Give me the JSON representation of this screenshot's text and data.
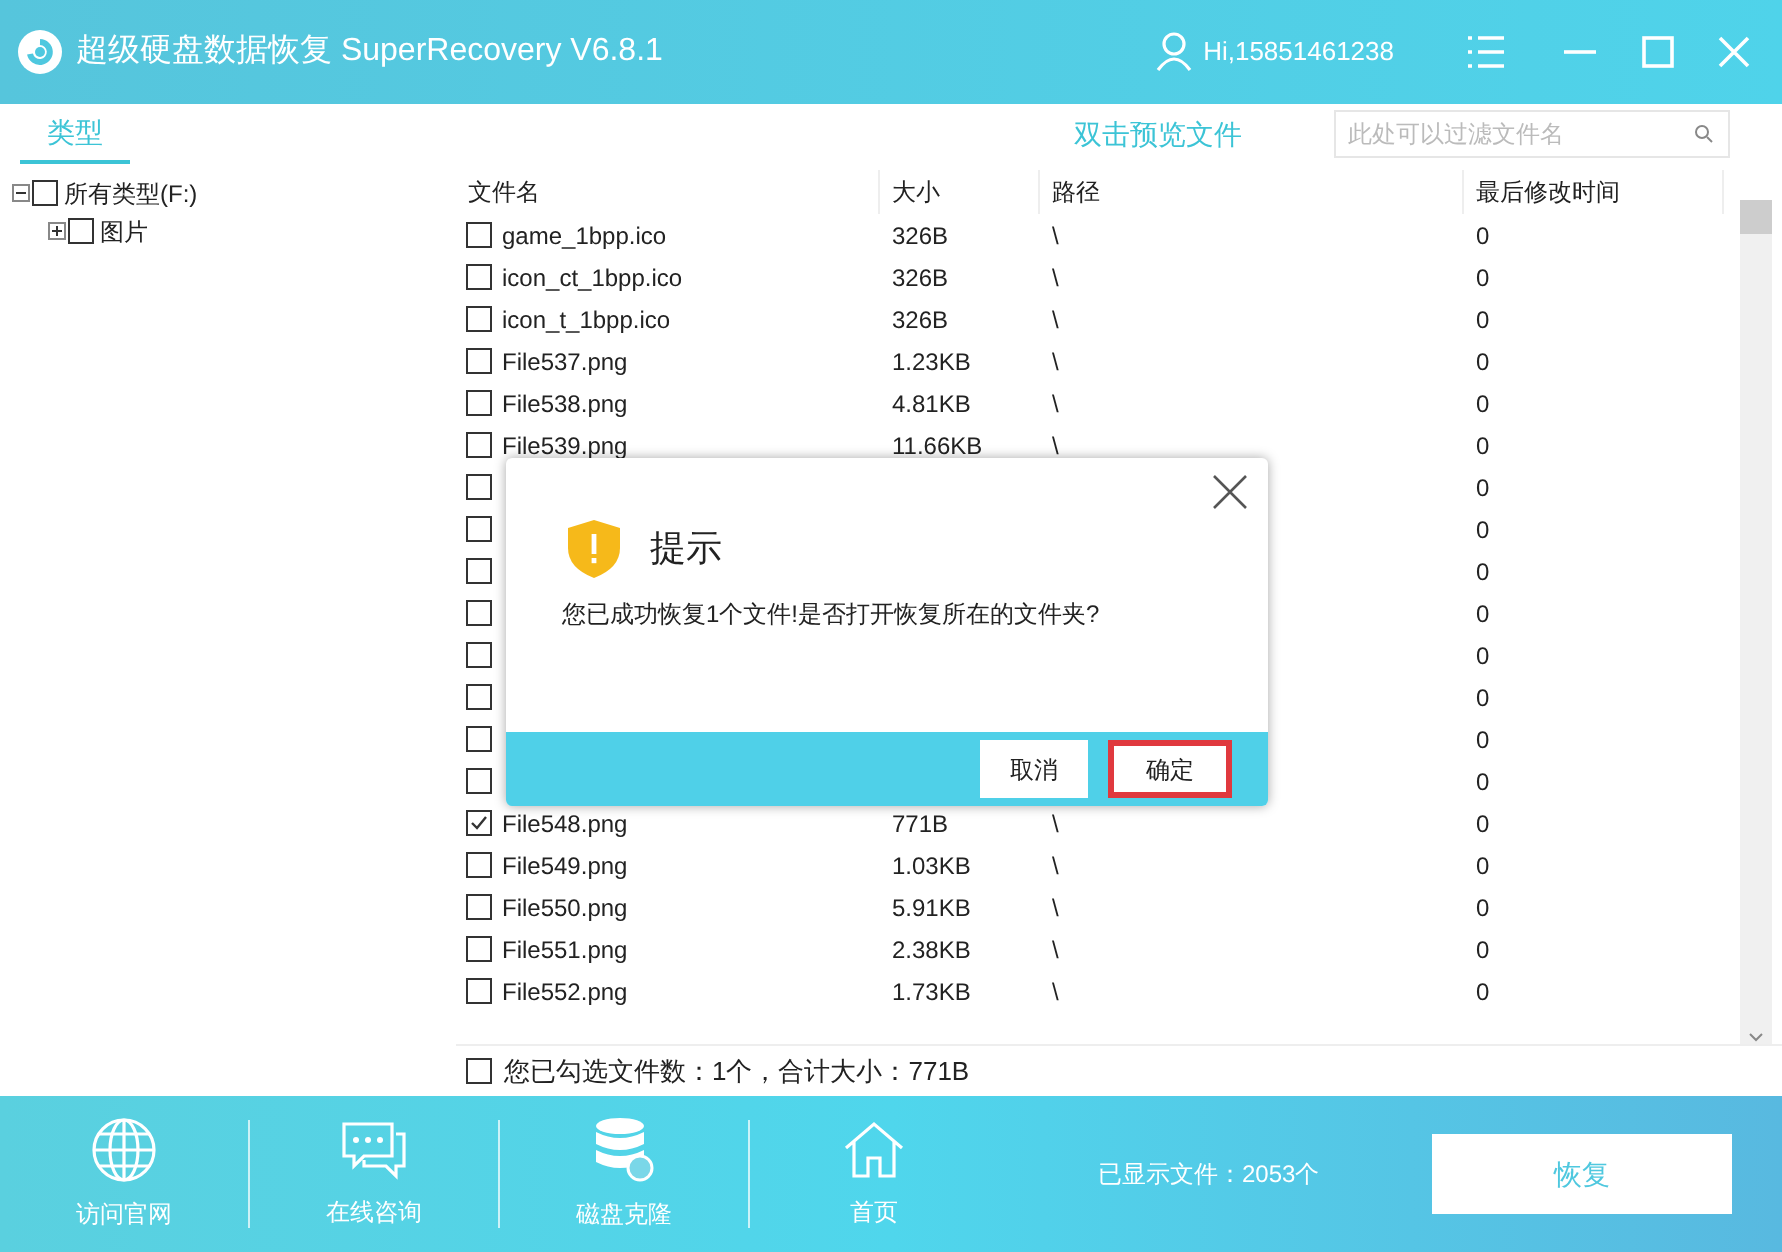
{
  "window": {
    "title": "超级硬盘数据恢复 SuperRecovery V6.8.1",
    "user": "Hi,15851461238"
  },
  "tabs": [
    {
      "label": "类型",
      "selected": true
    }
  ],
  "preview_hint": "双击预览文件",
  "search": {
    "placeholder": "此处可以过滤文件名"
  },
  "tree": [
    {
      "label": "所有类型(F:)",
      "expanded": true,
      "checked": false,
      "children": [
        {
          "label": "图片",
          "expanded": false,
          "checked": false
        }
      ]
    }
  ],
  "table": {
    "columns": [
      "文件名",
      "大小",
      "路径",
      "最后修改时间"
    ],
    "rows": [
      {
        "name": "game_1bpp.ico",
        "size": "326B",
        "path": "\\",
        "modified": "0",
        "checked": false
      },
      {
        "name": "icon_ct_1bpp.ico",
        "size": "326B",
        "path": "\\",
        "modified": "0",
        "checked": false
      },
      {
        "name": "icon_t_1bpp.ico",
        "size": "326B",
        "path": "\\",
        "modified": "0",
        "checked": false
      },
      {
        "name": "File537.png",
        "size": "1.23KB",
        "path": "\\",
        "modified": "0",
        "checked": false
      },
      {
        "name": "File538.png",
        "size": "4.81KB",
        "path": "\\",
        "modified": "0",
        "checked": false
      },
      {
        "name": "File539.png",
        "size": "11.66KB",
        "path": "\\",
        "modified": "0",
        "checked": false
      },
      {
        "modified": "0",
        "checked": false
      },
      {
        "modified": "0",
        "checked": false
      },
      {
        "modified": "0",
        "checked": false
      },
      {
        "modified": "0",
        "checked": false
      },
      {
        "modified": "0",
        "checked": false
      },
      {
        "modified": "0",
        "checked": false
      },
      {
        "modified": "0",
        "checked": false
      },
      {
        "modified": "0",
        "checked": false
      },
      {
        "name": "File548.png",
        "size": "771B",
        "path": "\\",
        "modified": "0",
        "checked": true
      },
      {
        "name": "File549.png",
        "size": "1.03KB",
        "path": "\\",
        "modified": "0",
        "checked": false
      },
      {
        "name": "File550.png",
        "size": "5.91KB",
        "path": "\\",
        "modified": "0",
        "checked": false
      },
      {
        "name": "File551.png",
        "size": "2.38KB",
        "path": "\\",
        "modified": "0",
        "checked": false
      },
      {
        "name": "File552.png",
        "size": "1.73KB",
        "path": "\\",
        "modified": "0",
        "checked": false
      }
    ]
  },
  "selection_summary": {
    "checked": false,
    "text": "您已勾选文件数：1个，合计大小：771B"
  },
  "bottom_nav": [
    {
      "kind": "globe",
      "label": "访问官网"
    },
    {
      "kind": "chat",
      "label": "在线咨询"
    },
    {
      "kind": "disk",
      "label": "磁盘克隆"
    },
    {
      "kind": "home",
      "label": "首页"
    }
  ],
  "file_count": "已显示文件：2053个",
  "recover_button": "恢复",
  "dialog": {
    "title": "提示",
    "message": "您已成功恢复1个文件!是否打开恢复所在的文件夹?",
    "buttons": [
      {
        "label": "取消",
        "highlighted": false
      },
      {
        "label": "确定",
        "highlighted": true
      }
    ]
  }
}
